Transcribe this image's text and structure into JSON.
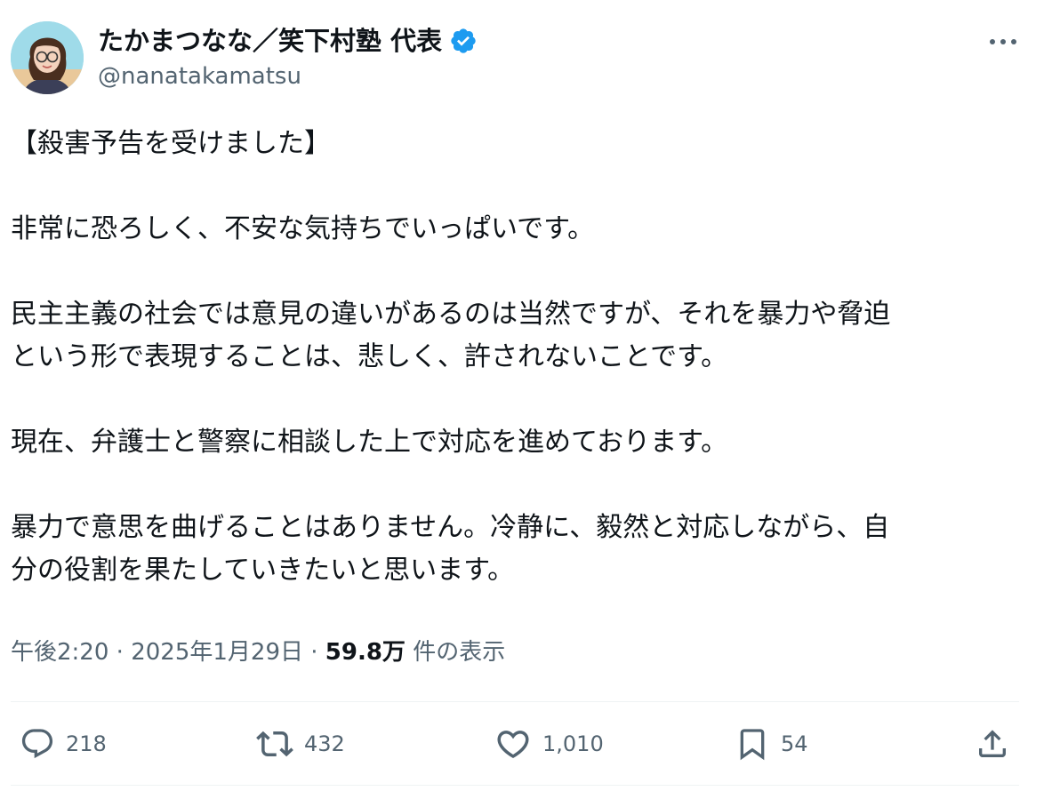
{
  "author": {
    "name": "たかまつなな／笑下村塾 代表",
    "handle": "@nanatakamatsu",
    "verified_badge_color": "#1d9bf0",
    "verified_icon": "verified-badge-icon"
  },
  "tweet": {
    "paragraphs": [
      [
        "【殺害予告を受けました】"
      ],
      [
        "非常に恐ろしく、不安な気持ちでいっぱいです。"
      ],
      [
        "民主主義の社会では意見の違いがあるのは当然ですが、それを暴力や脅迫",
        "という形で表現することは、悲しく、許されないことです。"
      ],
      [
        "現在、弁護士と警察に相談した上で対応を進めております。"
      ],
      [
        "暴力で意思を曲げることはありません。冷静に、毅然と対応しながら、自",
        "分の役割を果たしていきたいと思います。"
      ]
    ],
    "time": "午後2:20",
    "date": "2025年1月29日",
    "separator": "·",
    "views_count": "59.8万",
    "views_label": "件の表示"
  },
  "actions": {
    "reply": {
      "icon": "reply-icon",
      "count": "218"
    },
    "retweet": {
      "icon": "retweet-icon",
      "count": "432"
    },
    "like": {
      "icon": "heart-icon",
      "count": "1,010"
    },
    "bookmark": {
      "icon": "bookmark-icon",
      "count": "54"
    },
    "share": {
      "icon": "share-icon"
    }
  },
  "colors": {
    "text_primary": "#0f1419",
    "text_secondary": "#536471",
    "divider": "#eff3f4",
    "accent": "#1d9bf0"
  }
}
